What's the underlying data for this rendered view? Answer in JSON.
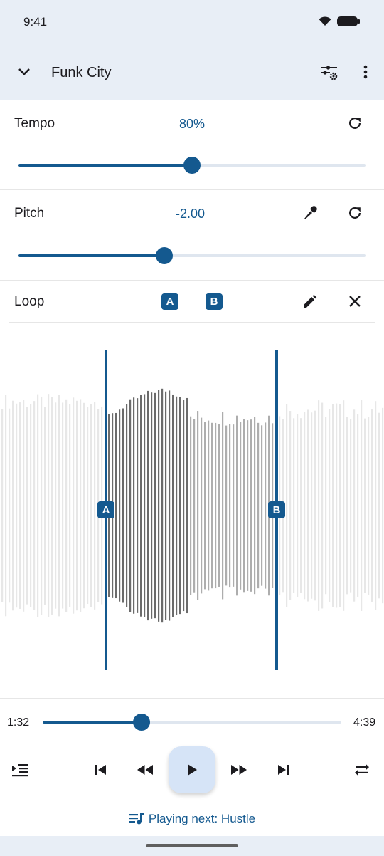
{
  "status": {
    "time": "9:41"
  },
  "app_bar": {
    "title": "Funk City"
  },
  "tempo": {
    "label": "Tempo",
    "value": "80%",
    "level": 0.5
  },
  "pitch": {
    "label": "Pitch",
    "value": "-2.00",
    "level": 0.42
  },
  "loop": {
    "label": "Loop",
    "a": "A",
    "b": "B"
  },
  "waveform": {
    "marker_a": "A",
    "marker_b": "B"
  },
  "playback": {
    "elapsed": "1:32",
    "total": "4:39",
    "progress": 0.33
  },
  "playing_next": "Playing next: Hustle",
  "colors": {
    "accent": "#14598f",
    "surface": "#e8eef6",
    "play_button": "#d6e4f7"
  },
  "icons": [
    "chevron-down-icon",
    "tune-icon",
    "more-vert-icon",
    "reset-icon",
    "mic-icon",
    "edit-icon",
    "close-icon",
    "queue-icon",
    "skip-previous-icon",
    "rewind-icon",
    "play-icon",
    "fast-forward-icon",
    "skip-next-icon",
    "repeat-icon",
    "playlist-icon"
  ]
}
